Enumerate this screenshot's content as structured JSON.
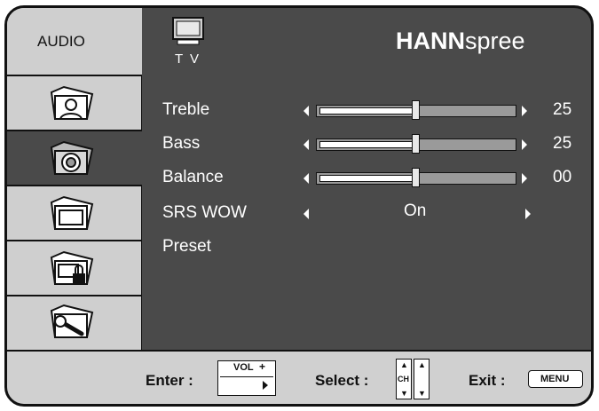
{
  "tabs": {
    "active_label": "AUDIO"
  },
  "source": {
    "label": "T V"
  },
  "brand": {
    "bold": "HANN",
    "light": "spree"
  },
  "settings": [
    {
      "label": "Treble",
      "value": "25",
      "level": 0.5
    },
    {
      "label": "Bass",
      "value": "25",
      "level": 0.5
    },
    {
      "label": "Balance",
      "value": "00",
      "level": 0.5
    }
  ],
  "srs": {
    "label": "SRS WOW",
    "value": "On"
  },
  "preset": {
    "label": "Preset"
  },
  "footer": {
    "enter_label": "Enter :",
    "vol_key": "VOL",
    "vol_plus": "+",
    "select_label": "Select :",
    "ch_key": "CH",
    "exit_label": "Exit :",
    "menu_key": "MENU"
  },
  "icons": [
    "tv-icon",
    "picture-icon",
    "audio-icon",
    "screen-icon",
    "lock-icon",
    "wrench-icon"
  ],
  "colors": {
    "panel": "#4a4a4a",
    "light": "#cfcfcf",
    "text": "#ffffff"
  }
}
